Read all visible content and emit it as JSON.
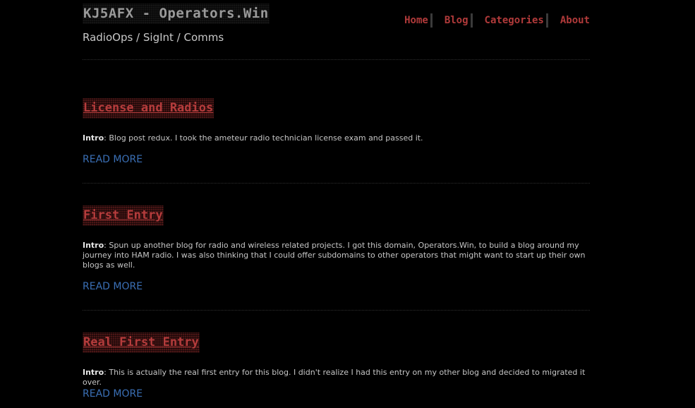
{
  "header": {
    "site_title": "KJ5AFX - Operators.Win",
    "tagline": "RadioOps / SigInt / Comms"
  },
  "nav": {
    "items": [
      {
        "label": "Home"
      },
      {
        "label": "Blog"
      },
      {
        "label": "Categories"
      },
      {
        "label": "About"
      }
    ]
  },
  "posts": [
    {
      "title": "License and Radios",
      "intro_label": "Intro",
      "intro_text": ": Blog post redux. I took the ameteur radio technician license exam and passed it.",
      "read_more": "READ MORE"
    },
    {
      "title": "First Entry",
      "intro_label": "Intro",
      "intro_text": ": Spun up another blog for radio and wireless related projects. I got this domain, Operators.Win, to build a blog around my journey into HAM radio. I was also thinking that I could offer subdomains to other operators that might want to start up their own blogs as well.",
      "read_more": "READ MORE"
    },
    {
      "title": "Real First Entry",
      "intro_label": "Intro",
      "intro_text": ": This is actually the real first entry for this blog. I didn't realize I had this entry on my other blog and decided to migrated it over.",
      "read_more": "READ MORE"
    }
  ],
  "colors": {
    "background": "#000000",
    "nav_link": "#b03a3a",
    "post_title": "#b53c3c",
    "read_more": "#3a6fb5"
  }
}
